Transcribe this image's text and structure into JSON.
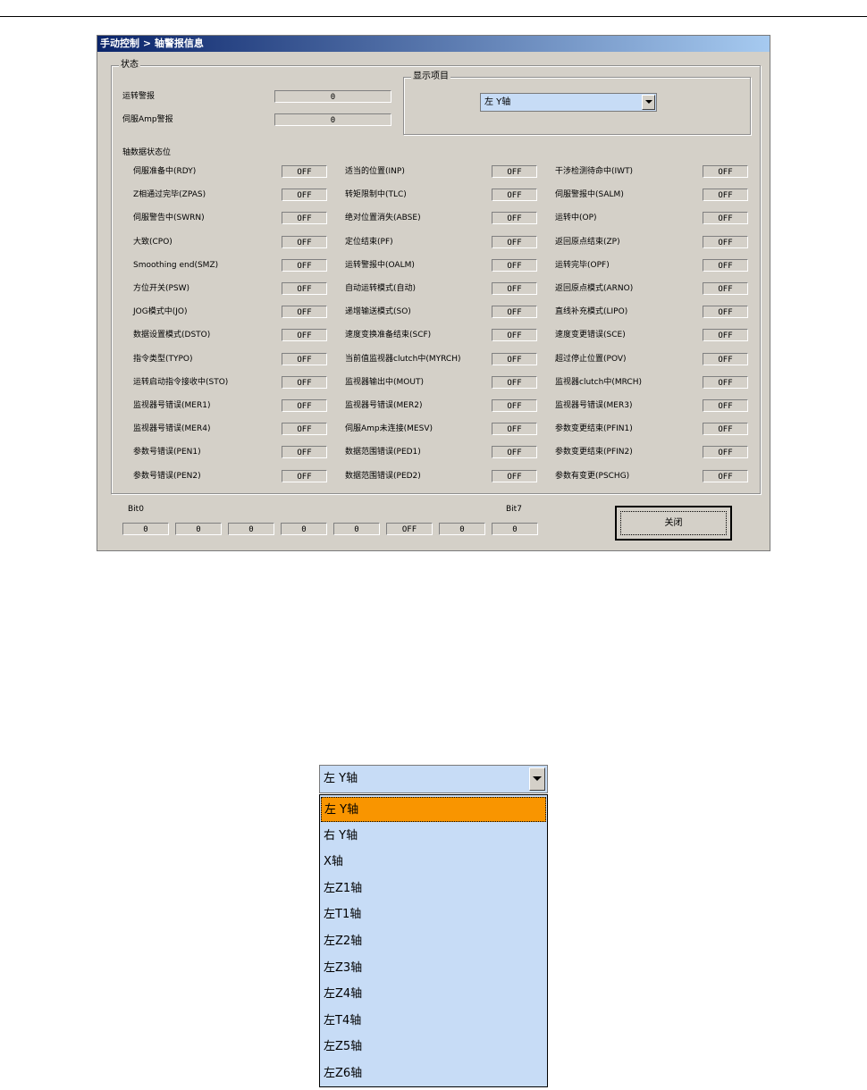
{
  "window": {
    "title": "手动控制 > 轴警报信息"
  },
  "status_group": {
    "title": "状态",
    "alarm": {
      "label": "运转警报",
      "value": "0"
    },
    "servo_alarm": {
      "label": "伺服Amp警报",
      "value": "0"
    }
  },
  "display_group": {
    "title": "显示项目",
    "selected": "左 Y轴"
  },
  "bits_title": "轴数据状态位",
  "bits": [
    [
      {
        "label": "伺服准备中(RDY)",
        "value": "OFF"
      },
      {
        "label": "适当的位置(INP)",
        "value": "OFF"
      },
      {
        "label": "干涉检测待命中(IWT)",
        "value": "OFF"
      }
    ],
    [
      {
        "label": "Z相通过完毕(ZPAS)",
        "value": "OFF"
      },
      {
        "label": "转矩限制中(TLC)",
        "value": "OFF"
      },
      {
        "label": "伺服警报中(SALM)",
        "value": "OFF"
      }
    ],
    [
      {
        "label": "伺服警告中(SWRN)",
        "value": "OFF"
      },
      {
        "label": "绝对位置消失(ABSE)",
        "value": "OFF"
      },
      {
        "label": "运转中(OP)",
        "value": "OFF"
      }
    ],
    [
      {
        "label": "大致(CPO)",
        "value": "OFF"
      },
      {
        "label": "定位结束(PF)",
        "value": "OFF"
      },
      {
        "label": "返回原点结束(ZP)",
        "value": "OFF"
      }
    ],
    [
      {
        "label": "Smoothing end(SMZ)",
        "value": "OFF"
      },
      {
        "label": "运转警报中(OALM)",
        "value": "OFF"
      },
      {
        "label": "运转完毕(OPF)",
        "value": "OFF"
      }
    ],
    [
      {
        "label": "方位开关(PSW)",
        "value": "OFF"
      },
      {
        "label": "自动运转模式(自动)",
        "value": "OFF"
      },
      {
        "label": "返回原点模式(ARNO)",
        "value": "OFF"
      }
    ],
    [
      {
        "label": "JOG模式中(JO)",
        "value": "OFF"
      },
      {
        "label": "递增输送模式(SO)",
        "value": "OFF"
      },
      {
        "label": "直线补充模式(LIPO)",
        "value": "OFF"
      }
    ],
    [
      {
        "label": "数据设置模式(DSTO)",
        "value": "OFF"
      },
      {
        "label": "速度变换准备结束(SCF)",
        "value": "OFF"
      },
      {
        "label": "速度变更错误(SCE)",
        "value": "OFF"
      }
    ],
    [
      {
        "label": "指令类型(TYPO)",
        "value": "OFF"
      },
      {
        "label": "当前值监视器clutch中(MYRCH)",
        "value": "OFF"
      },
      {
        "label": "超过停止位置(POV)",
        "value": "OFF"
      }
    ],
    [
      {
        "label": "运转启动指令接收中(STO)",
        "value": "OFF"
      },
      {
        "label": "监视器输出中(MOUT)",
        "value": "OFF"
      },
      {
        "label": "监视器clutch中(MRCH)",
        "value": "OFF"
      }
    ],
    [
      {
        "label": "监视器号错误(MER1)",
        "value": "OFF"
      },
      {
        "label": "监视器号错误(MER2)",
        "value": "OFF"
      },
      {
        "label": "监视器号错误(MER3)",
        "value": "OFF"
      }
    ],
    [
      {
        "label": "监视器号错误(MER4)",
        "value": "OFF"
      },
      {
        "label": "伺服Amp未连接(MESV)",
        "value": "OFF"
      },
      {
        "label": "参数变更结束(PFIN1)",
        "value": "OFF"
      }
    ],
    [
      {
        "label": "参数号错误(PEN1)",
        "value": "OFF"
      },
      {
        "label": "数据范围错误(PED1)",
        "value": "OFF"
      },
      {
        "label": "参数变更结束(PFIN2)",
        "value": "OFF"
      }
    ],
    [
      {
        "label": "参数号错误(PEN2)",
        "value": "OFF"
      },
      {
        "label": "数据范围错误(PED2)",
        "value": "OFF"
      },
      {
        "label": "参数有变更(PSCHG)",
        "value": "OFF"
      }
    ]
  ],
  "bit_row": {
    "label_start": "Bit0",
    "label_end": "Bit7",
    "values": [
      "0",
      "0",
      "0",
      "0",
      "0",
      "OFF",
      "0",
      "0"
    ]
  },
  "close_label": "关闭",
  "dropdown": {
    "selected": "左 Y轴",
    "options": [
      "左 Y轴",
      "右 Y轴",
      "X轴",
      "左Z1轴",
      "左T1轴",
      "左Z2轴",
      "左Z3轴",
      "左Z4轴",
      "左T4轴",
      "左Z5轴",
      "左Z6轴"
    ]
  }
}
